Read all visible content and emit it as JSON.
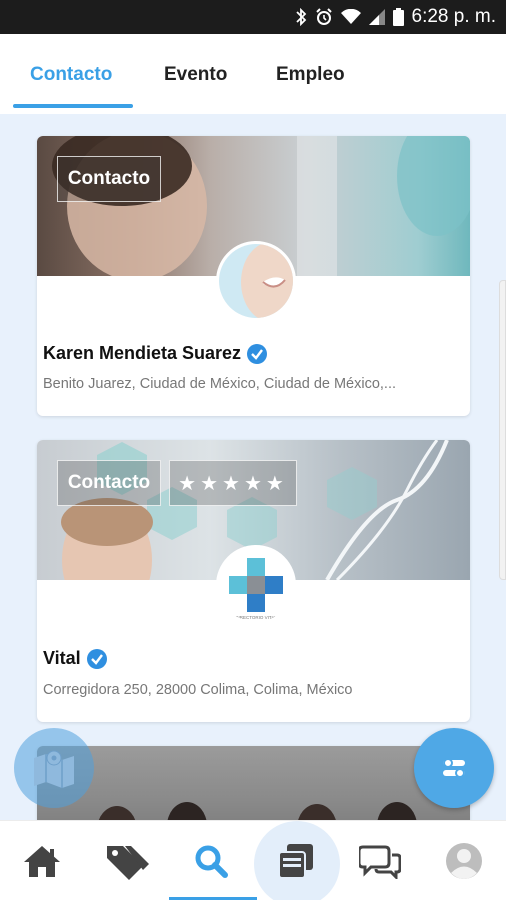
{
  "status_bar": {
    "time": "6:28 p. m."
  },
  "tabs": [
    {
      "label": "Contacto",
      "active": true
    },
    {
      "label": "Evento",
      "active": false
    },
    {
      "label": "Empleo",
      "active": false
    }
  ],
  "cards": [
    {
      "chip": "Contacto",
      "name": "Karen Mendieta Suarez",
      "address": "Benito Juarez, Ciudad de México, Ciudad de México,..."
    },
    {
      "chip": "Contacto",
      "rating_stars": "★★★★★",
      "rating": 5,
      "name": "Vital",
      "address": "Corregidora 250, 28000 Colima, Colima, México",
      "logo_text": "DIRECTORIO VITAL"
    }
  ],
  "colors": {
    "accent": "#3aa0e6",
    "tab_text": "#222222",
    "address": "#777777",
    "verified": "#2f8fe0"
  },
  "bottom_nav": [
    "home-icon",
    "tags-icon",
    "search-icon",
    "cards-icon",
    "chat-icon",
    "profile-icon"
  ],
  "active_nav": "search-icon"
}
